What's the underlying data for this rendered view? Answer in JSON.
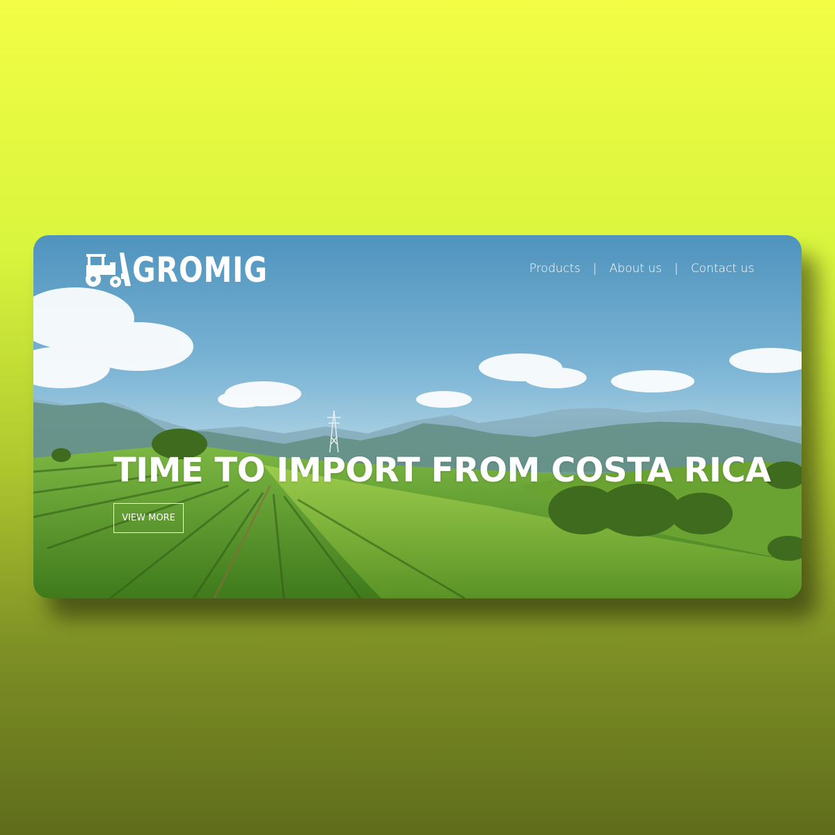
{
  "brand": {
    "name": "GROMIG",
    "logo_icon": "tractor-icon",
    "leaf_icon": "leaf-icon"
  },
  "nav": {
    "items": [
      {
        "label": "Products"
      },
      {
        "label": "About us"
      },
      {
        "label": "Contact us"
      }
    ],
    "separator": "|"
  },
  "hero": {
    "headline": "TIME TO IMPORT FROM COSTA RICA",
    "cta_label": "VIEW MORE",
    "background": "tea-plantation-landscape"
  },
  "colors": {
    "background_top": "#f2fd44",
    "background_bottom": "#5f6d1b",
    "text": "#ffffff",
    "sky": "#79b3d4",
    "field_green": "#5f9b2a"
  }
}
